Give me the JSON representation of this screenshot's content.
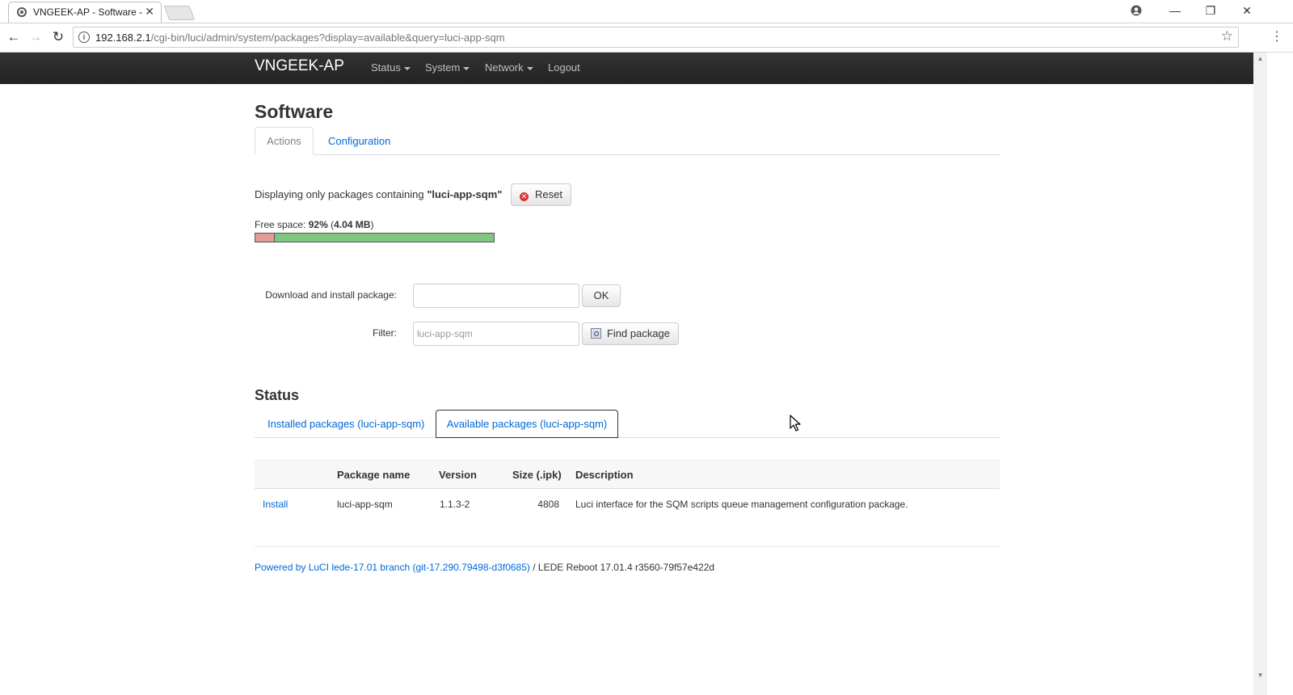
{
  "browser": {
    "tab_title": "VNGEEK-AP - Software - ",
    "url_host": "192.168.2.1",
    "url_path": "/cgi-bin/luci/admin/system/packages?display=available&query=luci-app-sqm"
  },
  "luci": {
    "brand": "VNGEEK-AP",
    "nav": [
      "Status",
      "System",
      "Network",
      "Logout"
    ]
  },
  "page": {
    "title": "Software",
    "tabs": [
      "Actions",
      "Configuration"
    ],
    "filter_note_prefix": "Displaying only packages containing",
    "filter_note_query": "\"luci-app-sqm\"",
    "reset_label": "Reset",
    "free_space_label": "Free space:",
    "free_space_percent": "92%",
    "free_space_size": "4.04 MB",
    "free_space_fraction": 0.92,
    "download_label": "Download and install package:",
    "download_value": "",
    "ok_label": "OK",
    "filter_label": "Filter:",
    "filter_placeholder": "luci-app-sqm",
    "find_label": "Find package"
  },
  "status": {
    "title": "Status",
    "tabs": [
      "Installed packages (luci-app-sqm)",
      "Available packages (luci-app-sqm)"
    ],
    "active_tab": 1,
    "columns": [
      "Package name",
      "Version",
      "Size (.ipk)",
      "Description"
    ],
    "rows": [
      {
        "action": "Install",
        "name": "luci-app-sqm",
        "version": "1.1.3-2",
        "size": "4808",
        "description": "Luci interface for the SQM scripts queue management configuration package."
      }
    ]
  },
  "footer": {
    "link_text": "Powered by LuCI lede-17.01 branch (git-17.290.79498-d3f0685)",
    "rest": " / LEDE Reboot 17.01.4 r3560-79f57e422d"
  },
  "colors": {
    "link": "#0069d6",
    "header_bg": "#222222",
    "freebar_used": "#e59a9a",
    "freebar_free": "#7fc77f"
  }
}
